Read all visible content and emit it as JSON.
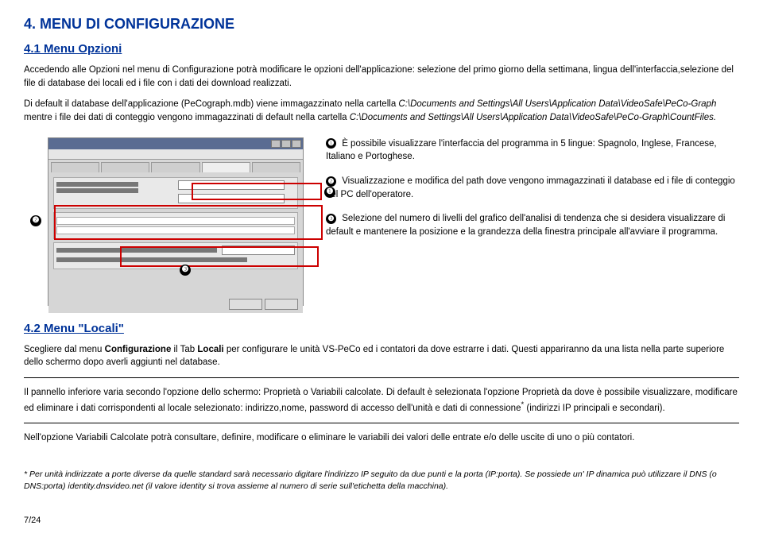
{
  "section4": {
    "title": "4. MENU DI CONFIGURAZIONE",
    "sub41_title": "4.1 Menu Opzioni",
    "p1": "Accedendo alle Opzioni nel menu di Configurazione potrà modificare le opzioni dell'applicazione: selezione del primo giorno della settimana, lingua dell'interfaccia,selezione del file di database dei locali ed i file con i dati dei download realizzati.",
    "p2_a": "Di default il database dell'applicazione (PeCograph.mdb) viene immagazzinato nella cartella ",
    "p2_path1": "C:\\Documents and Settings\\All Users\\Application Data\\VideoSafe\\PeCo-Graph",
    "p2_b": " mentre i file dei dati di conteggio vengono immagazzinati di default nella cartella ",
    "p2_path2": "C:\\Documents and Settings\\All Users\\Application Data\\VideoSafe\\PeCo-Graph\\CountFiles.",
    "features": {
      "f1": " È possibile visualizzare l'interfaccia del programma in 5 lingue: Spagnolo, Inglese, Francese, Italiano e Portoghese.",
      "f2": " Visualizzazione e modifica del path dove vengono immagazzinati il database ed i file di conteggio nel PC dell'operatore.",
      "f3": " Selezione del numero di livelli del grafico dell'analisi di tendenza che si desidera visualizzare di default e mantenere la posizione e la grandezza della finestra principale all'avviare il programma."
    },
    "sub42_title": "4.2 Menu \"Locali\"",
    "p42_1a": "Scegliere dal menu ",
    "p42_1b": "Configurazione",
    "p42_1c": " il Tab ",
    "p42_1d": "Locali",
    "p42_1e": " per configurare le unità VS-PeCo ed i contatori da dove estrarre i dati. Questi appariranno da una lista nella parte superiore dello schermo dopo averli aggiunti nel database.",
    "p42_2": "Il pannello inferiore varia secondo l'opzione dello schermo: Proprietà o Variabili calcolate. Di default è selezionata l'opzione Proprietà da dove è possibile visualizzare, modificare ed eliminare i dati corrispondenti al locale selezionato: indirizzo,nome, password di accesso dell'unità e dati di connessione",
    "p42_2b": " (indirizzi IP principali e secondari).",
    "p42_3": "Nell'opzione Variabili Calcolate potrà consultare, definire, modificare o eliminare le variabili dei valori delle entrate e/o delle uscite di uno o più contatori.",
    "footnote_marker": "*",
    "footnote": " Per unità indirizzate a porte diverse da quelle standard sarà necessario digitare l'indirizzo IP seguito da due punti e la porta (IP:porta). Se possiede un' IP dinamica può utilizzare il DNS (o DNS:porta) identity.dnsvideo.net (il valore identity si trova assieme al numero di serie sull'etichetta della macchina).",
    "pagenum": "7/24",
    "callouts": {
      "c1": "❶",
      "c2": "❷",
      "c3": "❸"
    }
  }
}
